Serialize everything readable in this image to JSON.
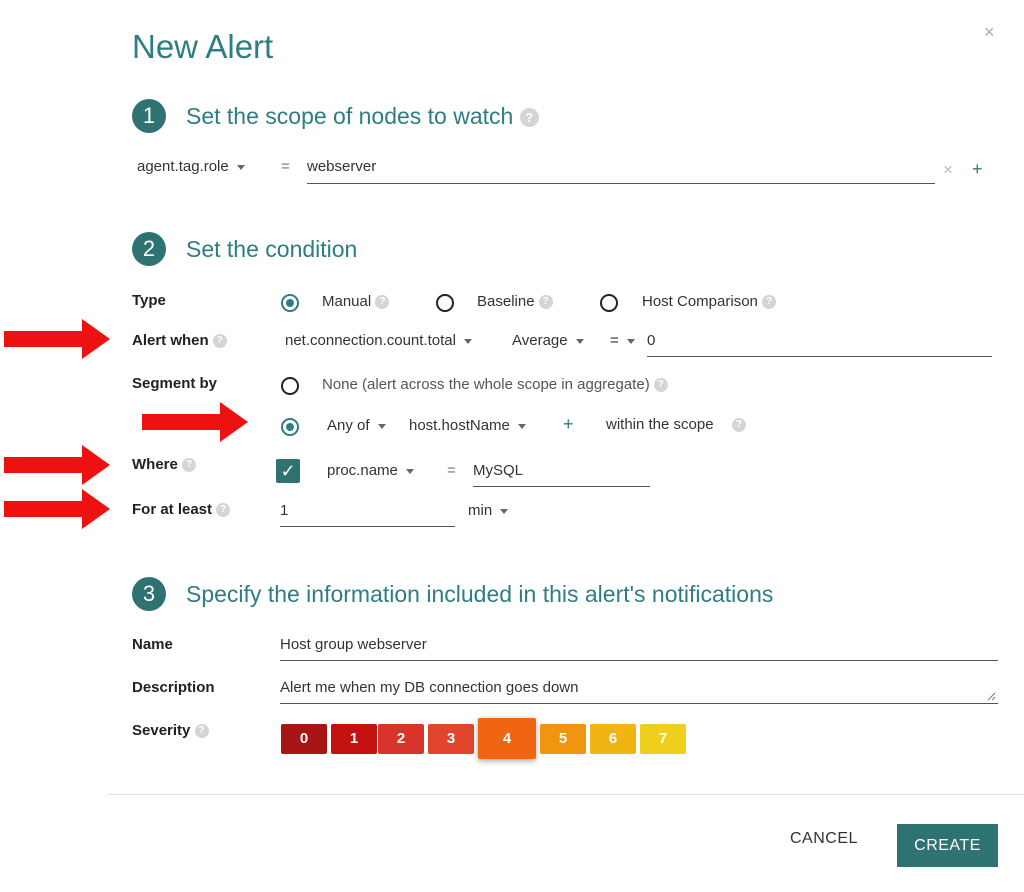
{
  "dialog": {
    "title": "New Alert",
    "close_glyph": "×"
  },
  "step1": {
    "number": "1",
    "title": "Set the scope of nodes to watch",
    "scope_key": "agent.tag.role",
    "operator": "=",
    "scope_value": "webserver",
    "clear_glyph": "×",
    "add_glyph": "+"
  },
  "step2": {
    "number": "2",
    "title": "Set the condition",
    "type_label": "Type",
    "type_options": [
      "Manual",
      "Baseline",
      "Host Comparison"
    ],
    "type_selected": "Manual",
    "alert_when_label": "Alert when",
    "metric": "net.connection.count.total",
    "aggregation": "Average",
    "comparator": "=",
    "threshold": "0",
    "segment_by_label": "Segment by",
    "segment_none": "None (alert across the whole scope in aggregate)",
    "segment_any_of": "Any of",
    "segment_field": "host.hostName",
    "segment_add": "+",
    "segment_scope": "within the scope",
    "where_label": "Where",
    "where_field": "proc.name",
    "where_operator": "=",
    "where_value": "MySQL",
    "for_at_least_label": "For at least",
    "duration_value": "1",
    "duration_unit": "min"
  },
  "step3": {
    "number": "3",
    "title": "Specify the information included in this alert's notifications",
    "name_label": "Name",
    "name_value": "Host group webserver",
    "description_label": "Description",
    "description_value": "Alert me when my DB connection goes down",
    "severity_label": "Severity",
    "severity_levels": [
      "0",
      "1",
      "2",
      "3",
      "4",
      "5",
      "6",
      "7"
    ],
    "severity_selected": "4"
  },
  "footer": {
    "cancel_label": "CANCEL",
    "create_label": "CREATE"
  },
  "colors": {
    "accent": "#2e7d82",
    "step_circle": "#2e7272",
    "arrow": "#ee1111",
    "severity": [
      "#a71514",
      "#c3110f",
      "#d9342a",
      "#e1452c",
      "#f06610",
      "#f2950e",
      "#f0b413",
      "#f0cf1c"
    ]
  },
  "icons": {
    "help": "question-circle-icon",
    "close": "close-icon",
    "caret": "caret-down-icon",
    "check": "checkmark-icon",
    "annotation": "red-arrow-icon"
  }
}
